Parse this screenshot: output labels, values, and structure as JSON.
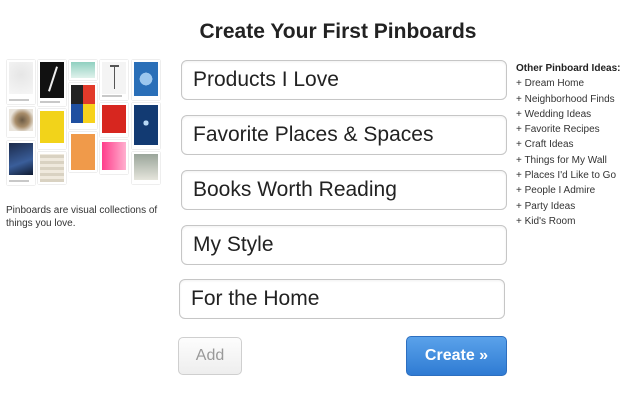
{
  "title": "Create Your First Pinboards",
  "tagline": "Pinboards are visual collections of things you love.",
  "boards": [
    "Products I Love",
    "Favorite Places & Spaces",
    "Books Worth Reading",
    "My Style",
    "For the Home"
  ],
  "buttons": {
    "add": "Add",
    "create": "Create »"
  },
  "ideas": {
    "heading": "Other Pinboard Ideas:",
    "items": [
      "+ Dream Home",
      "+ Neighborhood Finds",
      "+ Wedding Ideas",
      "+ Favorite Recipes",
      "+ Craft Ideas",
      "+ Things for My Wall",
      "+ Places I'd Like to Go",
      "+ People I Admire",
      "+ Party Ideas",
      "+ Kid's Room"
    ]
  },
  "colors": {
    "create_button": "#3b86d8",
    "text": "#222222"
  }
}
